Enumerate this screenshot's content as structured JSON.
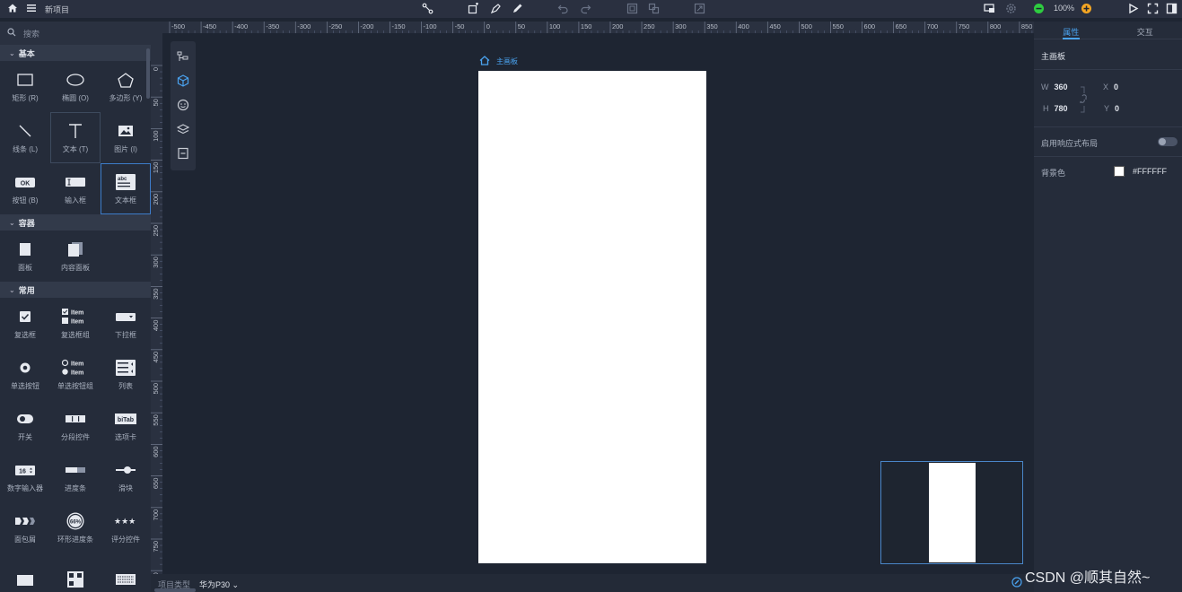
{
  "app": {
    "title": "新项目",
    "zoom": "100%"
  },
  "left_panel": {
    "search_placeholder": "搜索",
    "sections": [
      {
        "title": "基本",
        "items": [
          "矩形 (R)",
          "椭圆 (O)",
          "多边形 (Y)",
          "线条 (L)",
          "文本 (T)",
          "图片 (I)",
          "按钮 (B)",
          "输入框",
          "文本框"
        ]
      },
      {
        "title": "容器",
        "items": [
          "面板",
          "内容面板"
        ]
      },
      {
        "title": "常用",
        "items": [
          "复选框",
          "复选框组",
          "下拉框",
          "单选按钮",
          "单选按钮组",
          "列表",
          "开关",
          "分段控件",
          "选项卡",
          "数字输入器",
          "进度条",
          "滑块",
          "面包屑",
          "环形进度条",
          "评分控件"
        ]
      }
    ],
    "icon_texts": {
      "ok": "OK",
      "abc": "abc",
      "item": "Item",
      "num16": "16",
      "bitab": "biTab",
      "pct": "66%"
    }
  },
  "ruler": {
    "h_labels": [
      "-500",
      "-450",
      "-400",
      "-350",
      "-300",
      "-250",
      "-200",
      "-150",
      "-100",
      "-50",
      "0",
      "50",
      "100",
      "150",
      "200",
      "250",
      "300",
      "350",
      "400",
      "450",
      "500",
      "550",
      "600",
      "650",
      "700",
      "750",
      "800",
      "850"
    ],
    "v_labels": [
      "0",
      "50",
      "100",
      "150",
      "200",
      "250",
      "300",
      "350",
      "400",
      "450",
      "500",
      "550",
      "600",
      "650",
      "700",
      "750",
      "800"
    ]
  },
  "canvas": {
    "artboard_label": "主画板",
    "artboard_color": "#FFFFFF"
  },
  "bottom": {
    "project_type_label": "项目类型",
    "project_type_value": "华为P30"
  },
  "right_panel": {
    "tabs": [
      "属性",
      "交互"
    ],
    "title": "主画板",
    "w_label": "W",
    "w_value": "360",
    "h_label": "H",
    "h_value": "780",
    "x_label": "X",
    "x_value": "0",
    "y_label": "Y",
    "y_value": "0",
    "responsive_label": "启用响应式布局",
    "bg_label": "背景色",
    "bg_value": "#FFFFFF"
  },
  "watermark": "CSDN @顺其自然~",
  "colors": {
    "accent": "#4aa3f0",
    "bg": "#1e2532",
    "panel": "#252c3a"
  }
}
